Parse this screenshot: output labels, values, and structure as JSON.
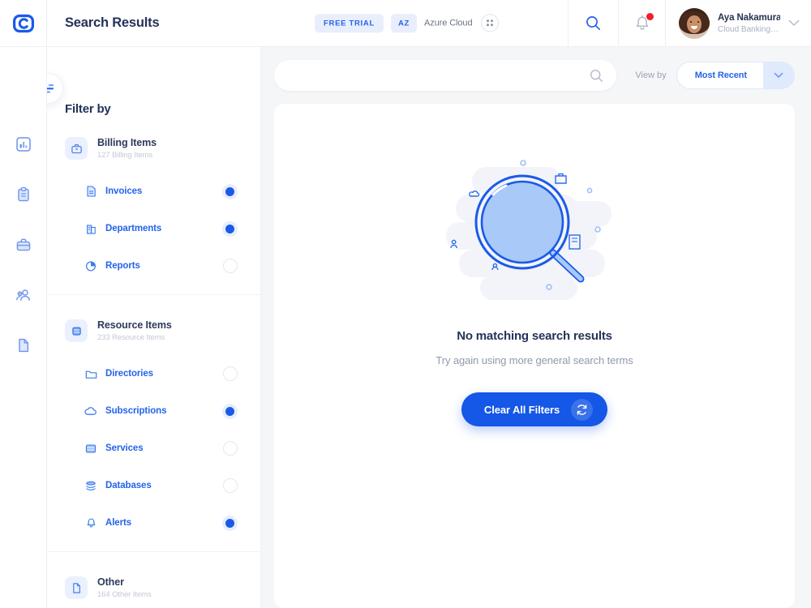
{
  "header": {
    "logo_icon": "c-logo-mark",
    "title": "Search Results",
    "badges": [
      {
        "label": "FREE TRIAL",
        "kind": "trial"
      },
      {
        "label": "AZ",
        "kind": "region"
      }
    ],
    "cloud_label": "Azure Cloud",
    "grid_icon": "grid-dots-icon",
    "search_icon": "search-icon",
    "bell_icon": "bell-icon",
    "has_notification": true,
    "user": {
      "name": "Aya Nakamura",
      "subtitle": "Cloud Banking Acc...",
      "chevron_icon": "chevron-down-icon"
    }
  },
  "rail": {
    "items": [
      {
        "icon": "analytics-chart-icon",
        "name": "analytics"
      },
      {
        "icon": "clipboard-icon",
        "name": "clipboard"
      },
      {
        "icon": "briefcase-icon",
        "name": "briefcase"
      },
      {
        "icon": "users-icon",
        "name": "users"
      },
      {
        "icon": "document-icon",
        "name": "documents"
      }
    ]
  },
  "filters": {
    "toggle_icon": "filter-sliders-icon",
    "heading": "Filter by",
    "groups": [
      {
        "title": "Billing Items",
        "subtitle": "127 Billing Items",
        "icon": "billing-briefcase-icon",
        "items": [
          {
            "label": "Invoices",
            "icon": "invoice-file-icon",
            "selected": true
          },
          {
            "label": "Departments",
            "icon": "building-icon",
            "selected": true
          },
          {
            "label": "Reports",
            "icon": "pie-chart-icon",
            "selected": false
          }
        ]
      },
      {
        "title": "Resource Items",
        "subtitle": "233 Resource Items",
        "icon": "database-icon",
        "items": [
          {
            "label": "Directories",
            "icon": "folder-icon",
            "selected": false
          },
          {
            "label": "Subscriptions",
            "icon": "cloud-icon",
            "selected": true
          },
          {
            "label": "Services",
            "icon": "server-icon",
            "selected": false
          },
          {
            "label": "Databases",
            "icon": "db-stack-icon",
            "selected": false
          },
          {
            "label": "Alerts",
            "icon": "bell-icon",
            "selected": true
          }
        ]
      },
      {
        "title": "Other",
        "subtitle": "164 Other Items",
        "icon": "document-icon",
        "items": []
      }
    ]
  },
  "main": {
    "search": {
      "value": "",
      "placeholder": "",
      "icon": "search-icon"
    },
    "view_by": {
      "label": "View by",
      "selected": "Most Recent",
      "options": [
        "Most Recent"
      ],
      "chevron_icon": "chevron-down-icon"
    },
    "empty_state": {
      "illustration": "magnifying-glass-illustration",
      "title": "No matching search results",
      "subtitle": "Try again using more general search terms",
      "button_label": "Clear All Filters",
      "button_icon": "refresh-sync-icon"
    }
  },
  "colors": {
    "primary": "#1557e6",
    "accent_blue": "#2563eb",
    "lens_fill": "#a9c9f8",
    "canvas": "#f5f6f8",
    "notification": "#f01f2c",
    "title_navy": "#243258"
  }
}
